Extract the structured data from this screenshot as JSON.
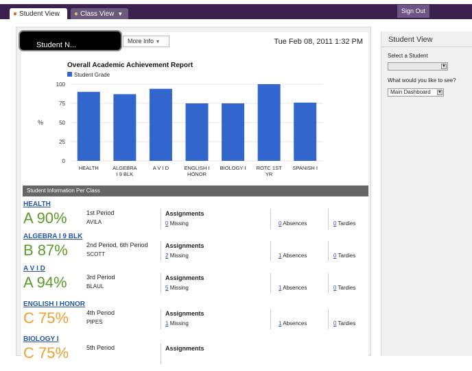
{
  "tabs": [
    {
      "label": "Student View",
      "icon": "student-icon",
      "active": true
    },
    {
      "label": "Class View",
      "icon": "class-icon",
      "active": false
    }
  ],
  "signout_label": "Sign Out",
  "header": {
    "more_info_label": "More Info",
    "datetime": "Tue Feb 08, 2011 1:32 PM",
    "popup_text": "Student N..."
  },
  "chart_data": {
    "type": "bar",
    "title": "Overall Academic Achievement Report",
    "legend": "Student Grade",
    "ylabel": "%",
    "ylim": [
      0,
      100
    ],
    "yticks": [
      "0",
      "25",
      "50",
      "75",
      "100"
    ],
    "categories": [
      [
        "HEALTH"
      ],
      [
        "ALGEBRA",
        "I 9 BLK"
      ],
      [
        "A V I D"
      ],
      [
        "ENGLISH I",
        "HONOR"
      ],
      [
        "BIOLOGY I"
      ],
      [
        "ROTC 1ST",
        "YR"
      ],
      [
        "SPANISH I"
      ]
    ],
    "values": [
      90,
      87,
      94,
      75,
      75,
      100,
      76
    ],
    "bar_color": "#3366cc"
  },
  "section_header": "Student Information Per Class",
  "classes": [
    {
      "name": "HEALTH",
      "grade": "A 90%",
      "grade_color": "#5a9a2a",
      "period": "1st Period",
      "teacher": "AVILA",
      "assignments_label": "Assignments",
      "missing_count": "0",
      "missing_label": "Missing",
      "absences_count": "0",
      "absences_label": "Absences",
      "tardies_count": "0",
      "tardies_label": "Tardies"
    },
    {
      "name": "ALGEBRA I 9 BLK",
      "grade": "B 87%",
      "grade_color": "#5a9a2a",
      "period": "2nd Period, 6th Period",
      "teacher": "SCOTT",
      "assignments_label": "Assignments",
      "missing_count": "2",
      "missing_label": "Missing",
      "absences_count": "1",
      "absences_label": "Absences",
      "tardies_count": "0",
      "tardies_label": "Tardies"
    },
    {
      "name": "A V I D",
      "grade": "A 94%",
      "grade_color": "#5a9a2a",
      "period": "3rd Period",
      "teacher": "BLAUL",
      "assignments_label": "Assignments",
      "missing_count": "5",
      "missing_label": "Missing",
      "absences_count": "1",
      "absences_label": "Absences",
      "tardies_count": "0",
      "tardies_label": "Tardies"
    },
    {
      "name": "ENGLISH I HONOR",
      "grade": "C 75%",
      "grade_color": "#f0a030",
      "period": "4th Period",
      "teacher": "PIPES",
      "assignments_label": "Assignments",
      "missing_count": "1",
      "missing_label": "Missing",
      "absences_count": "1",
      "absences_label": "Absences",
      "tardies_count": "0",
      "tardies_label": "Tardies"
    },
    {
      "name": "BIOLOGY I",
      "grade": "C 75%",
      "grade_color": "#f0a030",
      "period": "5th Period",
      "teacher": "",
      "assignments_label": "Assignments",
      "missing_count": "",
      "missing_label": "",
      "absences_count": "",
      "absences_label": "",
      "tardies_count": "",
      "tardies_label": ""
    }
  ],
  "sidebar": {
    "title": "Student View",
    "select_student_label": "Select a Student",
    "select_student_value": "",
    "see_label": "What would you like to see?",
    "see_value": "Main Dashboard"
  }
}
